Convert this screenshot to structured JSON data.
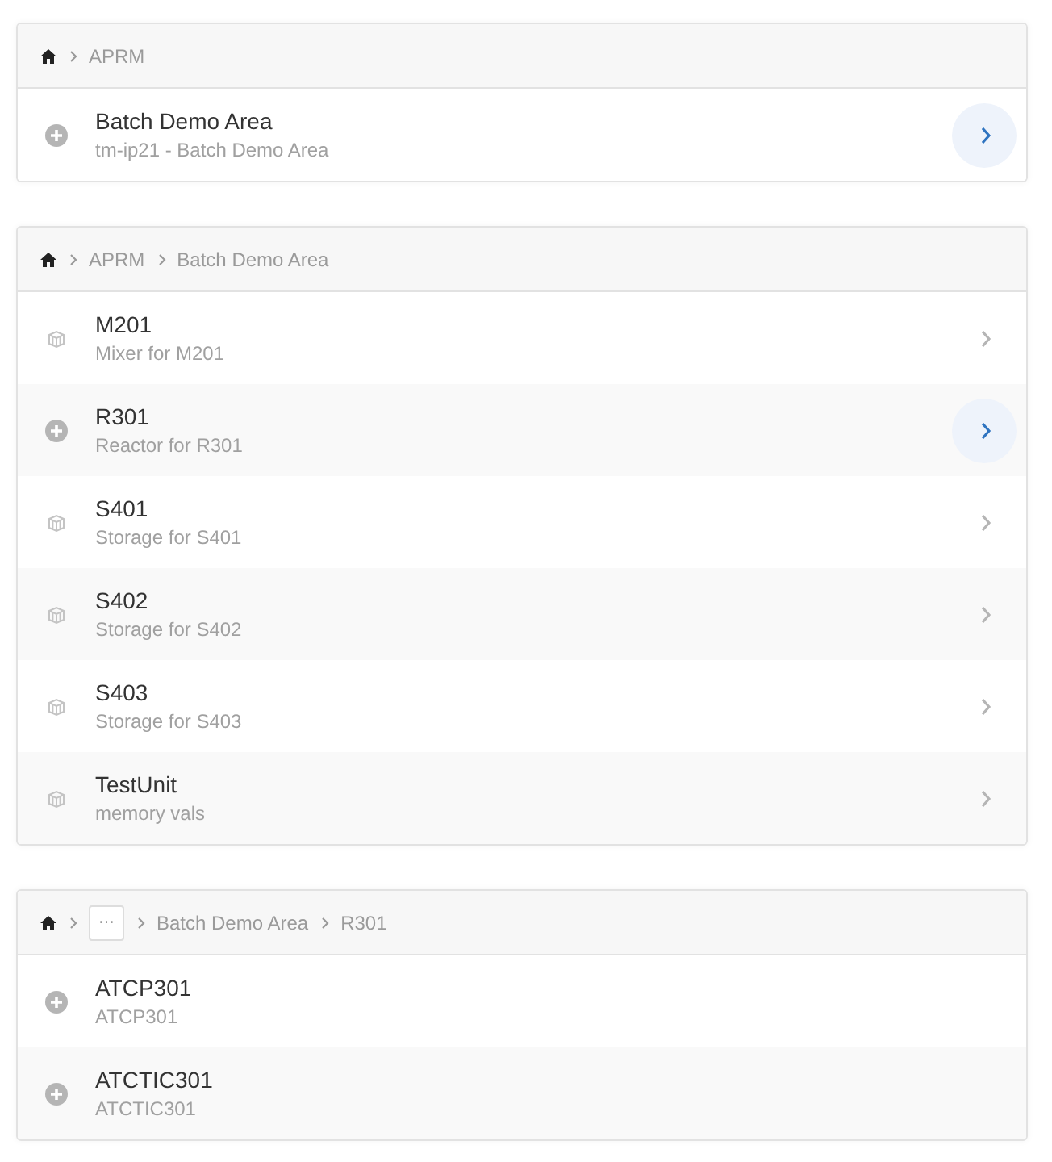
{
  "panels": [
    {
      "breadcrumb": [
        {
          "kind": "text",
          "label": "APRM"
        }
      ],
      "rows": [
        {
          "kind": "group",
          "title": "Batch Demo Area",
          "subtitle": "tm-ip21 - Batch Demo Area",
          "navigable": true,
          "highlighted": true
        }
      ]
    },
    {
      "breadcrumb": [
        {
          "kind": "text",
          "label": "APRM"
        },
        {
          "kind": "text",
          "label": "Batch Demo Area"
        }
      ],
      "rows": [
        {
          "kind": "unit",
          "title": "M201",
          "subtitle": "Mixer for M201",
          "navigable": true,
          "highlighted": false
        },
        {
          "kind": "group",
          "title": "R301",
          "subtitle": "Reactor for R301",
          "navigable": true,
          "highlighted": true
        },
        {
          "kind": "unit",
          "title": "S401",
          "subtitle": "Storage for S401",
          "navigable": true,
          "highlighted": false
        },
        {
          "kind": "unit",
          "title": "S402",
          "subtitle": "Storage for S402",
          "navigable": true,
          "highlighted": false
        },
        {
          "kind": "unit",
          "title": "S403",
          "subtitle": "Storage for S403",
          "navigable": true,
          "highlighted": false
        },
        {
          "kind": "unit",
          "title": "TestUnit",
          "subtitle": "memory vals",
          "navigable": true,
          "highlighted": false
        }
      ]
    },
    {
      "breadcrumb": [
        {
          "kind": "ellipsis",
          "label": "···"
        },
        {
          "kind": "text",
          "label": "Batch Demo Area"
        },
        {
          "kind": "text",
          "label": "R301"
        }
      ],
      "rows": [
        {
          "kind": "group",
          "title": "ATCP301",
          "subtitle": "ATCP301",
          "navigable": false
        },
        {
          "kind": "group",
          "title": "ATCTIC301",
          "subtitle": "ATCTIC301",
          "navigable": false
        }
      ]
    }
  ]
}
